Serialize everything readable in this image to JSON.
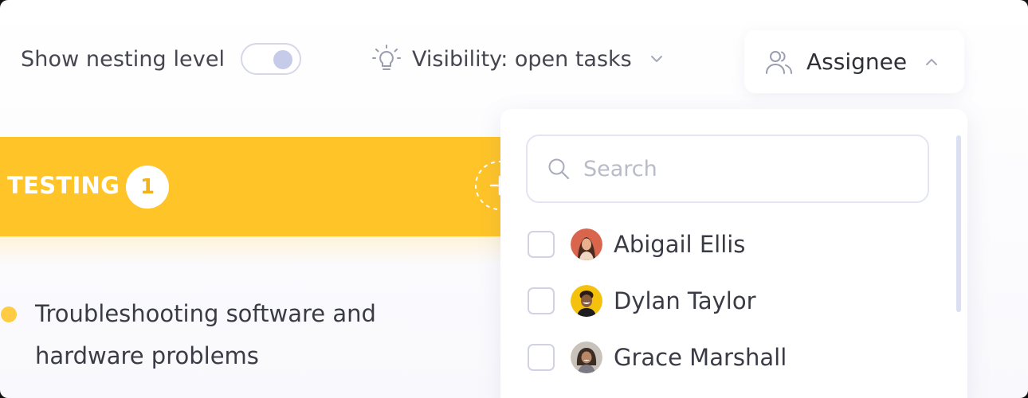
{
  "toolbar": {
    "nesting_label": "Show nesting level",
    "nesting_enabled": true,
    "visibility_label": "Visibility: open tasks",
    "assignee_label": "Assignee"
  },
  "column": {
    "title": "TESTING",
    "count": "1",
    "color": "#ffc427"
  },
  "task": {
    "text": "Troubleshooting software and hardware problems",
    "status_color": "#ffcc44"
  },
  "assignee_dropdown": {
    "search_placeholder": "Search",
    "users": [
      {
        "name": "Abigail Ellis",
        "checked": false,
        "avatar_icon": "avatar-abigail-ellis"
      },
      {
        "name": "Dylan Taylor",
        "checked": false,
        "avatar_icon": "avatar-dylan-taylor"
      },
      {
        "name": "Grace Marshall",
        "checked": false,
        "avatar_icon": "avatar-grace-marshall"
      }
    ]
  },
  "colors": {
    "accent": "#ffc427",
    "toggle_knob": "#c7cbea",
    "text": "#3a3b45"
  }
}
